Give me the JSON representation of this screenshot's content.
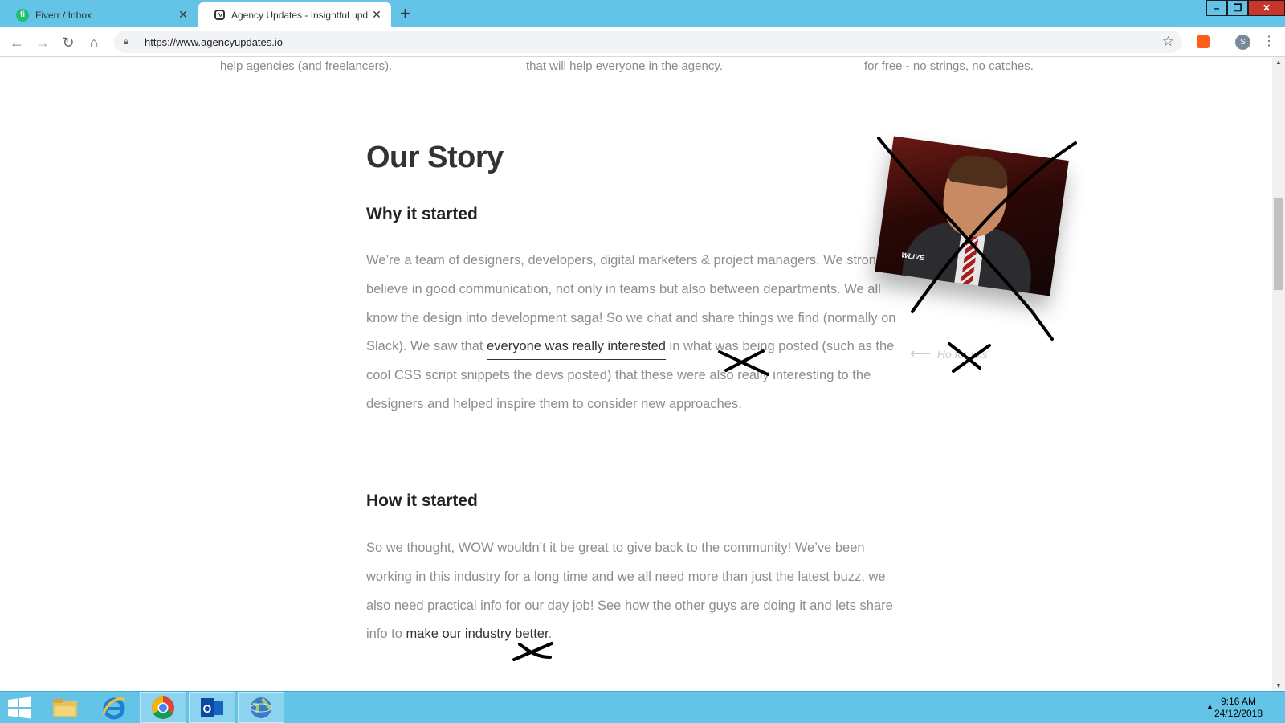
{
  "browser": {
    "tabs": [
      {
        "title": "Fiverr / Inbox",
        "active": false,
        "favicon": "fiverr-icon"
      },
      {
        "title": "Agency Updates - Insightful upd",
        "active": true,
        "favicon": "agency-updates-icon"
      }
    ],
    "url": "https://www.agencyupdates.io",
    "profile_initial": "S"
  },
  "page": {
    "features": [
      "help agencies (and freelancers).",
      "that will help everyone in the agency.",
      "for free - no strings, no catches."
    ],
    "story_title": "Our Story",
    "why": {
      "heading": "Why it started",
      "text_before": "We’re a team of designers, developers, digital marketers & project managers. We strongly believe in good communication, not only in teams but also between departments. We all know the design into development saga! So we chat and share things we find (normally on Slack). We saw that ",
      "link": "everyone was really interested",
      "text_after": " in what was being posted (such as the cool CSS script snippets the devs posted) that these were also really interesting to the designers and helped inspire them to consider new approaches."
    },
    "how": {
      "heading": "How it started",
      "text_before": "So we thought, WOW wouldn’t it be great to give back to the community! We’ve been working in this industry for a long time and we all need more than just the latest buzz, we also need practical info for our day job! See how the other guys are doing it and lets share info to ",
      "link": "make our industry better",
      "text_after": "."
    },
    "photo_note": "Ho   for lols",
    "photo_logo": "WLIVE"
  },
  "taskbar": {
    "apps": [
      "start-icon",
      "file-explorer-icon",
      "internet-explorer-icon",
      "chrome-icon",
      "outlook-icon",
      "globe-icon"
    ],
    "time": "9:16 AM",
    "date": "24/12/2018"
  },
  "colors": {
    "chrome_frame": "#64c4e8",
    "text_body": "#8d8d8d",
    "heading": "#333333",
    "scribble": "#000000"
  }
}
